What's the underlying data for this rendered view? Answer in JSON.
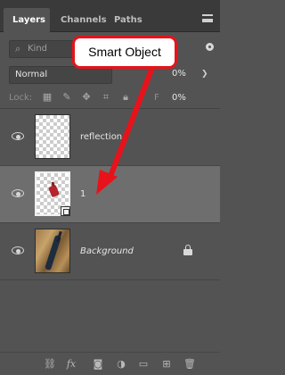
{
  "tabs": [
    "Layers",
    "Channels",
    "Paths"
  ],
  "filter": {
    "placeholder": "Kind"
  },
  "blend_mode": "Normal",
  "opacity": "0%",
  "lock": {
    "label": "Lock:"
  },
  "fill": {
    "label": "F",
    "value": "0%"
  },
  "layers": [
    {
      "name": "reflection",
      "visible": true,
      "selected": false,
      "type": "transparent"
    },
    {
      "name": "1",
      "visible": true,
      "selected": true,
      "type": "smart-object"
    },
    {
      "name": "Background",
      "visible": true,
      "selected": false,
      "type": "image",
      "locked": true
    }
  ],
  "annotation": {
    "text": "Smart Object",
    "color": "#e8121a"
  },
  "footer_icons": [
    "link-icon",
    "fx-icon",
    "mask-icon",
    "adjustment-icon",
    "folder-icon",
    "new-layer-icon",
    "trash-icon"
  ],
  "colors": {
    "panel": "#535353",
    "selected": "#6e6e6e",
    "tabbar": "#3a3a3a"
  }
}
